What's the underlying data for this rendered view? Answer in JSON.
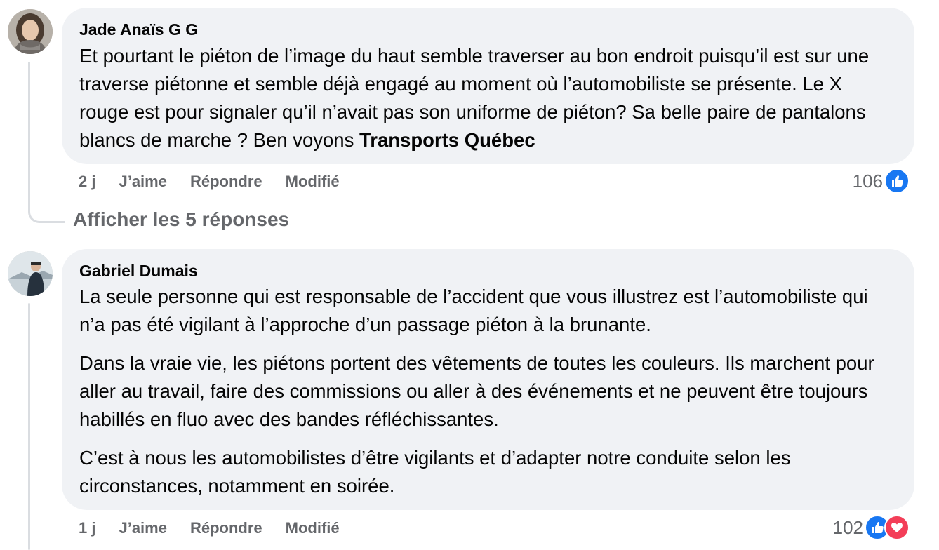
{
  "comments": [
    {
      "author": "Jade Anaïs G G",
      "text_before": "Et pourtant le piéton de l’image du haut semble traverser au bon endroit puisqu’il est sur une traverse piétonne et semble déjà engagé au moment où l’automobiliste se présente. Le X rouge est pour signaler qu’il n’avait pas son uniforme de piéton? Sa belle paire de pantalons blancs de marche ? Ben voyons ",
      "mention": "Transports Québec",
      "time": "2 j",
      "like_label": "J’aime",
      "reply_label": "Répondre",
      "edited_label": "Modifié",
      "reaction_count": "106",
      "reactions": [
        "like-icon"
      ],
      "view_replies_label": "Afficher les 5 réponses"
    },
    {
      "author": "Gabriel Dumais",
      "paragraphs": [
        "La seule personne qui est responsable de l’accident que vous illustrez est l’automobiliste qui n’a pas été vigilant à l’approche d’un passage piéton à la brunante.",
        "Dans la vraie vie, les piétons portent des vêtements de toutes les couleurs. Ils marchent pour aller au travail, faire des commissions ou aller à des événements et ne peuvent être toujours habillés en fluo avec des bandes réfléchissantes.",
        "C’est à nous les automobilistes d’être vigilants et d’adapter notre conduite selon les circonstances, notamment en soirée."
      ],
      "time": "1 j",
      "like_label": "J’aime",
      "reply_label": "Répondre",
      "edited_label": "Modifié",
      "reaction_count": "102",
      "reactions": [
        "like-icon",
        "love-icon"
      ]
    }
  ],
  "colors": {
    "bubble": "#f0f2f5",
    "meta_text": "#65676b",
    "like_blue": "#1877f2",
    "love_red": "#f33e58"
  }
}
